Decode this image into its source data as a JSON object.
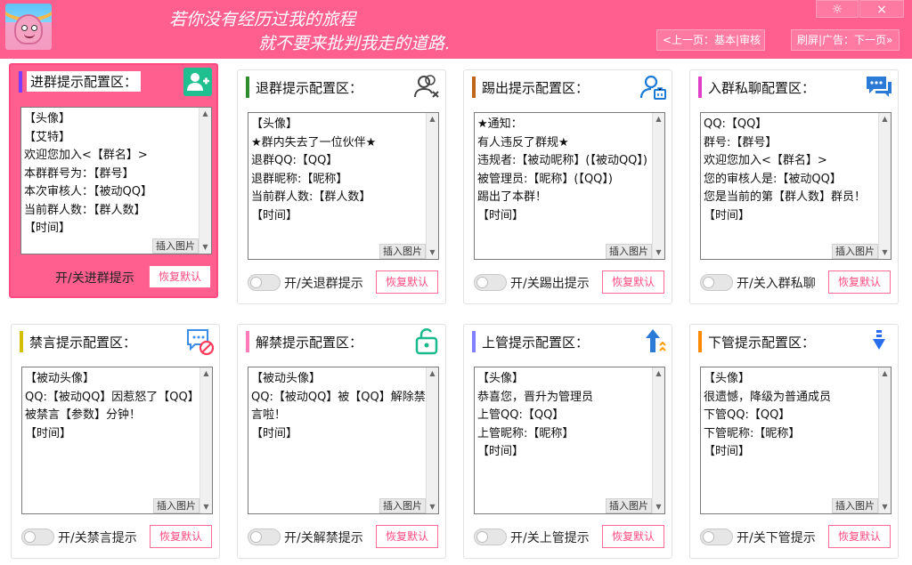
{
  "header": {
    "slogan_line1": "若你没有经历过我的旅程",
    "slogan_line2": "就不要来批判我走的道路.",
    "window_controls": {
      "minimize_symbol": "☼",
      "close_symbol": "×"
    },
    "nav_prev": "<上一页：基本|审核",
    "nav_next": "刷屏|广告：下一页»"
  },
  "common": {
    "insert_image_label": "插入图片",
    "reset_label": "恢复默认"
  },
  "cards": [
    {
      "title": "进群提示配置区：",
      "bar_color": "#7a3cff",
      "icon": "user-add-icon",
      "text": "【头像】\n【艾特】\n欢迎您加入<【群名】>\n本群群号为：【群号】\n本次审核人：【被动QQ】\n当前群人数：【群人数】\n【时间】",
      "toggle_label": "开/关进群提示",
      "active": true
    },
    {
      "title": "退群提示配置区：",
      "bar_color": "#2e8b2e",
      "icon": "user-remove-icon",
      "text": "【头像】\n★群内失去了一位伙伴★\n退群QQ:【QQ】\n退群昵称:【昵称】\n当前群人数:【群人数】\n【时间】",
      "toggle_label": "开/关退群提示",
      "active": false
    },
    {
      "title": "踢出提示配置区：",
      "bar_color": "#c0661a",
      "icon": "user-kick-icon",
      "text": "★通知：\n有人违反了群规★\n违规者:【被动昵称】(【被动QQ】)\n被管理员:【昵称】(【QQ】)\n踢出了本群！\n【时间】",
      "toggle_label": "开/关踢出提示",
      "active": false
    },
    {
      "title": "入群私聊配置区：",
      "bar_color": "#e040c8",
      "icon": "chat-icon",
      "text": "QQ:【QQ】\n群号:【群号】\n欢迎您加入<【群名】>\n您的审核人是:【被动QQ】\n您是当前的第【群人数】群员！\n【时间】",
      "toggle_label": "开/关入群私聊",
      "active": false
    },
    {
      "title": "禁言提示配置区：",
      "bar_color": "#d4c000",
      "icon": "mute-icon",
      "text": "【被动头像】\nQQ:【被动QQ】因惹怒了【QQ】被禁言【参数】分钟！\n【时间】",
      "toggle_label": "开/关禁言提示",
      "active": false
    },
    {
      "title": "解禁提示配置区：",
      "bar_color": "#ff7ab8",
      "icon": "unlock-icon",
      "text": "【被动头像】\nQQ:【被动QQ】被【QQ】解除禁言啦！\n【时间】",
      "toggle_label": "开/关解禁提示",
      "active": false
    },
    {
      "title": "上管提示配置区：",
      "bar_color": "#8080ff",
      "icon": "promote-icon",
      "text": "【头像】\n恭喜您，晋升为管理员\n上管QQ:【QQ】\n上管昵称:【昵称】\n【时间】",
      "toggle_label": "开/关上管提示",
      "active": false
    },
    {
      "title": "下管提示配置区：",
      "bar_color": "#ff8a00",
      "icon": "demote-icon",
      "text": "【头像】\n很遗憾，降级为普通成员\n下管QQ:【QQ】\n下管昵称:【昵称】\n【时间】",
      "toggle_label": "开/关下管提示",
      "active": false
    }
  ]
}
